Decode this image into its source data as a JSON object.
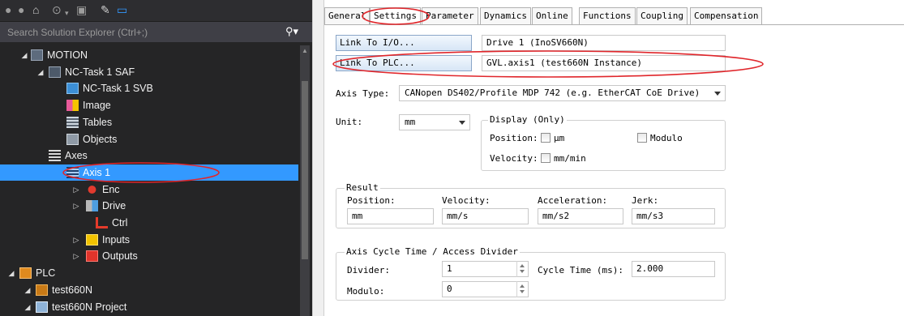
{
  "explorer": {
    "search_placeholder": "Search Solution Explorer (Ctrl+;)",
    "tree": [
      {
        "label": "MOTION",
        "twisty": "◢",
        "icon": "motion-icon"
      },
      {
        "label": "NC-Task 1 SAF",
        "twisty": "◢",
        "icon": "nc-task-icon"
      },
      {
        "label": "NC-Task 1 SVB",
        "twisty": "",
        "icon": "nc-task-svb-icon"
      },
      {
        "label": "Image",
        "twisty": "",
        "icon": "image-icon"
      },
      {
        "label": "Tables",
        "twisty": "",
        "icon": "tables-icon"
      },
      {
        "label": "Objects",
        "twisty": "",
        "icon": "objects-icon"
      },
      {
        "label": "Axes",
        "twisty": "◢",
        "icon": "axes-icon"
      },
      {
        "label": "Axis 1",
        "twisty": "◢",
        "icon": "axis-icon"
      },
      {
        "label": "Enc",
        "twisty": "▷",
        "icon": "encoder-icon"
      },
      {
        "label": "Drive",
        "twisty": "▷",
        "icon": "drive-icon"
      },
      {
        "label": "Ctrl",
        "twisty": "",
        "icon": "controller-icon"
      },
      {
        "label": "Inputs",
        "twisty": "▷",
        "icon": "inputs-icon"
      },
      {
        "label": "Outputs",
        "twisty": "▷",
        "icon": "outputs-icon"
      },
      {
        "label": "PLC",
        "twisty": "◢",
        "icon": "plc-icon"
      },
      {
        "label": "test660N",
        "twisty": "◢",
        "icon": "plc-project-icon"
      },
      {
        "label": "test660N Project",
        "twisty": "◢",
        "icon": "project-icon"
      }
    ],
    "selected_item": "Axis 1"
  },
  "tabs": [
    "General",
    "Settings",
    "Parameter",
    "Dynamics",
    "Online",
    "Functions",
    "Coupling",
    "Compensation"
  ],
  "active_tab": "Settings",
  "settings": {
    "link_io_button": "Link To I/O...",
    "link_io_value": "Drive 1 (InoSV660N)",
    "link_plc_button": "Link To PLC...",
    "link_plc_value": "GVL.axis1 (test660N Instance)",
    "axis_type_label": "Axis Type:",
    "axis_type_value": "CANopen DS402/Profile MDP 742 (e.g. EtherCAT CoE Drive)",
    "unit_label": "Unit:",
    "unit_value": "mm",
    "display_group": "Display (Only)",
    "display_position_label": "Position:",
    "display_position_unit": "µm",
    "display_modulo": "Modulo",
    "display_velocity_label": "Velocity:",
    "display_velocity_unit": "mm/min",
    "result_group": "Result",
    "result": {
      "position_label": "Position:",
      "position_value": "mm",
      "velocity_label": "Velocity:",
      "velocity_value": "mm/s",
      "acceleration_label": "Acceleration:",
      "acceleration_value": "mm/s2",
      "jerk_label": "Jerk:",
      "jerk_value": "mm/s3"
    },
    "cycle_group": "Axis Cycle Time / Access Divider",
    "divider_label": "Divider:",
    "divider_value": "1",
    "cycle_time_label": "Cycle Time (ms):",
    "cycle_time_value": "2.000",
    "modulo_label": "Modulo:",
    "modulo_value": "0"
  },
  "colors": {
    "explorer_bg": "#252526",
    "selection": "#3399ff",
    "annotation": "#e0262b"
  }
}
